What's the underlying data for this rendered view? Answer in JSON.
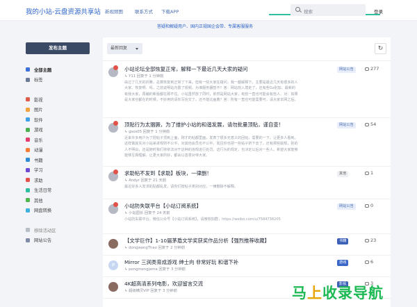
{
  "header": {
    "brand": "我的小站-云盘资源共享站",
    "nav": [
      "新视频图",
      "联系方式",
      "下载APP"
    ],
    "search_placeholder": "搜索",
    "login": "登录"
  },
  "banner": "答疑和解疑用户、国内正规国企会带、专属客服服务",
  "sidebar": {
    "post_button": "发布主题",
    "items": [
      {
        "label": "全部主题",
        "color": "#3b6fd9",
        "active": true
      },
      {
        "label": "标签",
        "color": "#6b7a99"
      },
      {
        "label": "影视",
        "color": "#e05a4e"
      },
      {
        "label": "图片",
        "color": "#f0a23b"
      },
      {
        "label": "软件",
        "color": "#3fa0e6"
      },
      {
        "label": "游戏",
        "color": "#4caf50"
      },
      {
        "label": "音乐",
        "color": "#e53d6b"
      },
      {
        "label": "动漫",
        "color": "#f57b39"
      },
      {
        "label": "书籍",
        "color": "#2c8bd8"
      },
      {
        "label": "学习",
        "color": "#6c4ad6"
      },
      {
        "label": "求助",
        "color": "#e0524a"
      },
      {
        "label": "生活日常",
        "color": "#2fbfa0"
      },
      {
        "label": "其他",
        "color": "#52b84a"
      },
      {
        "label": "网盘转换",
        "color": "#3fb0e0"
      },
      {
        "label": "移除活动区",
        "color": "#b9bdc6",
        "gray": true
      },
      {
        "label": "网站公告",
        "color": "#7d8aa8"
      }
    ]
  },
  "toolbar": {
    "sort_label": "最新回复",
    "refresh_icon": "refresh-icon"
  },
  "topics": [
    {
      "title": "小站论坛全部恢复正常，解释一下最近几天大家的疑问",
      "meta": "Y11 回复于 1 分钟前",
      "excerpt": "由过了几天的折腾，总算恢复到正常了下来。但有一些大家在疑问，我一都解释下。主要是最近几天有很多的人大家、恢复啊、吗，之前说明站内置了视频。为准服务器暂不？答：网站前入境走了，还有些Gz别加、最新的有我大家，再编的新版都在那不住。小站虽然放了同时，依然是网站大家，有些一直也可能会有些人、对：如果是大家也都在的时候，不好用的请你写信交了。还不能比画着？答：所有一直也可能需要可，请大家本网之后。",
      "tag": "网站公告",
      "tag_style": "light",
      "count": "277"
    },
    {
      "title": "顶贴行为太猖獗，为了维护小站的和谐发展，请勿批量顶贴，谨自查！",
      "meta": "gsos05 回复于 1 分钟前",
      "excerpt": "近来许多用户为了把帖子顶到上面，刚才的帖都里面，发表了很多无意义的回帖，需要的一下。让更多人看到。这样做其实对小站来讲规则不公平，对其他会员也不公平。而且你也把一些帖子挤下去了，还有那些版规，别的人不明白，还是随时我们将依法对于这种的违规进行处罚。这行为的规定，也决定以后对一些人。希望大家能够能够互相理解，让更大家的好，都会以善意对待大家。",
      "tag": "网站公告",
      "tag_style": "light",
      "count": "54"
    },
    {
      "title": "求助帖不发到【求助】板块，一律删！",
      "meta": "Andyr 回复于 21 天前",
      "excerpt": "最近好多人发求助贴都乱发，请你们按帖子类别对应，一律删除不解释。",
      "tag": "其他",
      "tag_style": "gray",
      "count": "1"
    },
    {
      "title": "小站防失联平台【小站订阅系统】",
      "meta": "小站园长 回复于 24 天前",
      "excerpt": "小站防失联平台。微信公众号【小站订阅系统】，请微软加群，https://weibo.com/u/7584738205",
      "tag": "网站公告",
      "tag_style": "light",
      "count": "0"
    },
    {
      "title": "【文学巨作】1-10届茅盾文学奖获奖作品分析【强烈推荐收藏】",
      "meta": "dongwangThao 回复于 2 分钟前",
      "excerpt": "",
      "tag": "书籍",
      "tag_style": "solid",
      "count": "23"
    },
    {
      "title": "Mirror 三涧类育成游戏 绅士向 非常好玩 和谐下补",
      "meta": "pengmengjama 回复于 3 分钟前",
      "excerpt": "",
      "tag": "游戏",
      "tag_style": "solid2",
      "count": "6"
    },
    {
      "title": "4K超高清系列电影，欢迎留言交流",
      "meta": "超级精灵VIP 回复于 3 分钟前",
      "excerpt": "",
      "tag": "影视",
      "tag_style": "solid",
      "count": "3"
    }
  ]
}
